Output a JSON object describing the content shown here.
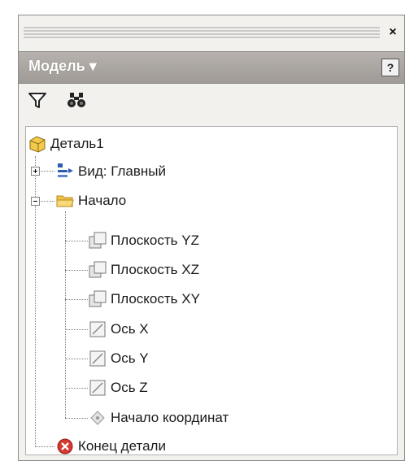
{
  "panel": {
    "title": "Модель",
    "title_arrow": "▾",
    "help_label": "?",
    "close_label": "×"
  },
  "toolbar": {
    "filter_icon": "filter-icon",
    "find_icon": "binoculars-icon"
  },
  "tree": {
    "root": {
      "label": "Деталь1",
      "icon": "part-icon"
    },
    "view": {
      "label": "Вид: Главный",
      "icon": "view-icon",
      "expander": "plus"
    },
    "origin": {
      "label": "Начало",
      "icon": "folder-icon",
      "expander": "minus"
    },
    "origin_items": [
      {
        "label": "Плоскость YZ",
        "icon": "plane-icon"
      },
      {
        "label": "Плоскость XZ",
        "icon": "plane-icon"
      },
      {
        "label": "Плоскость XY",
        "icon": "plane-icon"
      },
      {
        "label": "Ось X",
        "icon": "axis-icon"
      },
      {
        "label": "Ось Y",
        "icon": "axis-icon"
      },
      {
        "label": "Ось Z",
        "icon": "axis-icon"
      },
      {
        "label": "Начало координат",
        "icon": "center-point-icon"
      }
    ],
    "end": {
      "label": "Конец детали",
      "icon": "end-of-part-icon"
    }
  },
  "colors": {
    "header_bg": "#a9a49f",
    "folder": "#f0c24a",
    "end_marker": "#d6392f"
  }
}
